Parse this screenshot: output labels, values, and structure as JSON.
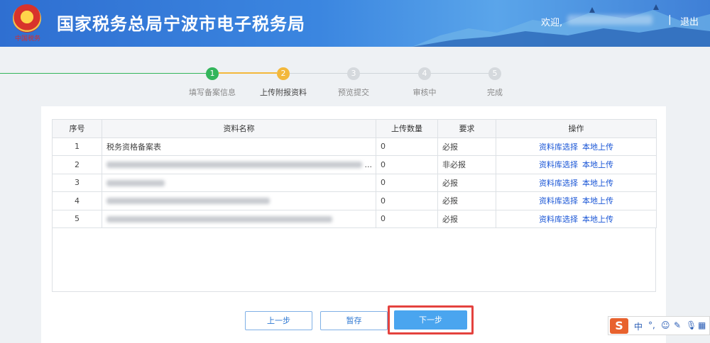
{
  "header": {
    "site_title": "国家税务总局宁波市电子税务局",
    "emblem_caption": "中国税务",
    "welcome": "欢迎,",
    "separator": "|",
    "logout": "退出"
  },
  "steps": [
    {
      "num": "1",
      "label": "填写备案信息",
      "state": "done"
    },
    {
      "num": "2",
      "label": "上传附报资料",
      "state": "active"
    },
    {
      "num": "3",
      "label": "预览提交",
      "state": "todo"
    },
    {
      "num": "4",
      "label": "审核中",
      "state": "todo"
    },
    {
      "num": "5",
      "label": "完成",
      "state": "todo"
    }
  ],
  "table": {
    "headers": [
      "序号",
      "资料名称",
      "上传数量",
      "要求",
      "操作"
    ],
    "rows": [
      {
        "no": "1",
        "name": "税务资格备案表",
        "count": "0",
        "req": "必报"
      },
      {
        "no": "2",
        "name": "",
        "suffix": "...",
        "count": "0",
        "req": "非必报"
      },
      {
        "no": "3",
        "name": "",
        "count": "0",
        "req": "必报"
      },
      {
        "no": "4",
        "name": "",
        "count": "0",
        "req": "必报"
      },
      {
        "no": "5",
        "name": "",
        "count": "0",
        "req": "必报"
      }
    ],
    "op_select": "资料库选择",
    "op_upload": "本地上传"
  },
  "buttons": {
    "prev": "上一步",
    "save": "暂存",
    "next": "下一步"
  },
  "ime": {
    "logo": "S",
    "lang": "中",
    "punct": "°,"
  },
  "colors": {
    "header": "#3b86e0",
    "step_done": "#33b55b",
    "step_active": "#f3b83b",
    "link": "#1a56d6",
    "primary_button": "#4aa5ef",
    "highlight": "#e4423e"
  }
}
